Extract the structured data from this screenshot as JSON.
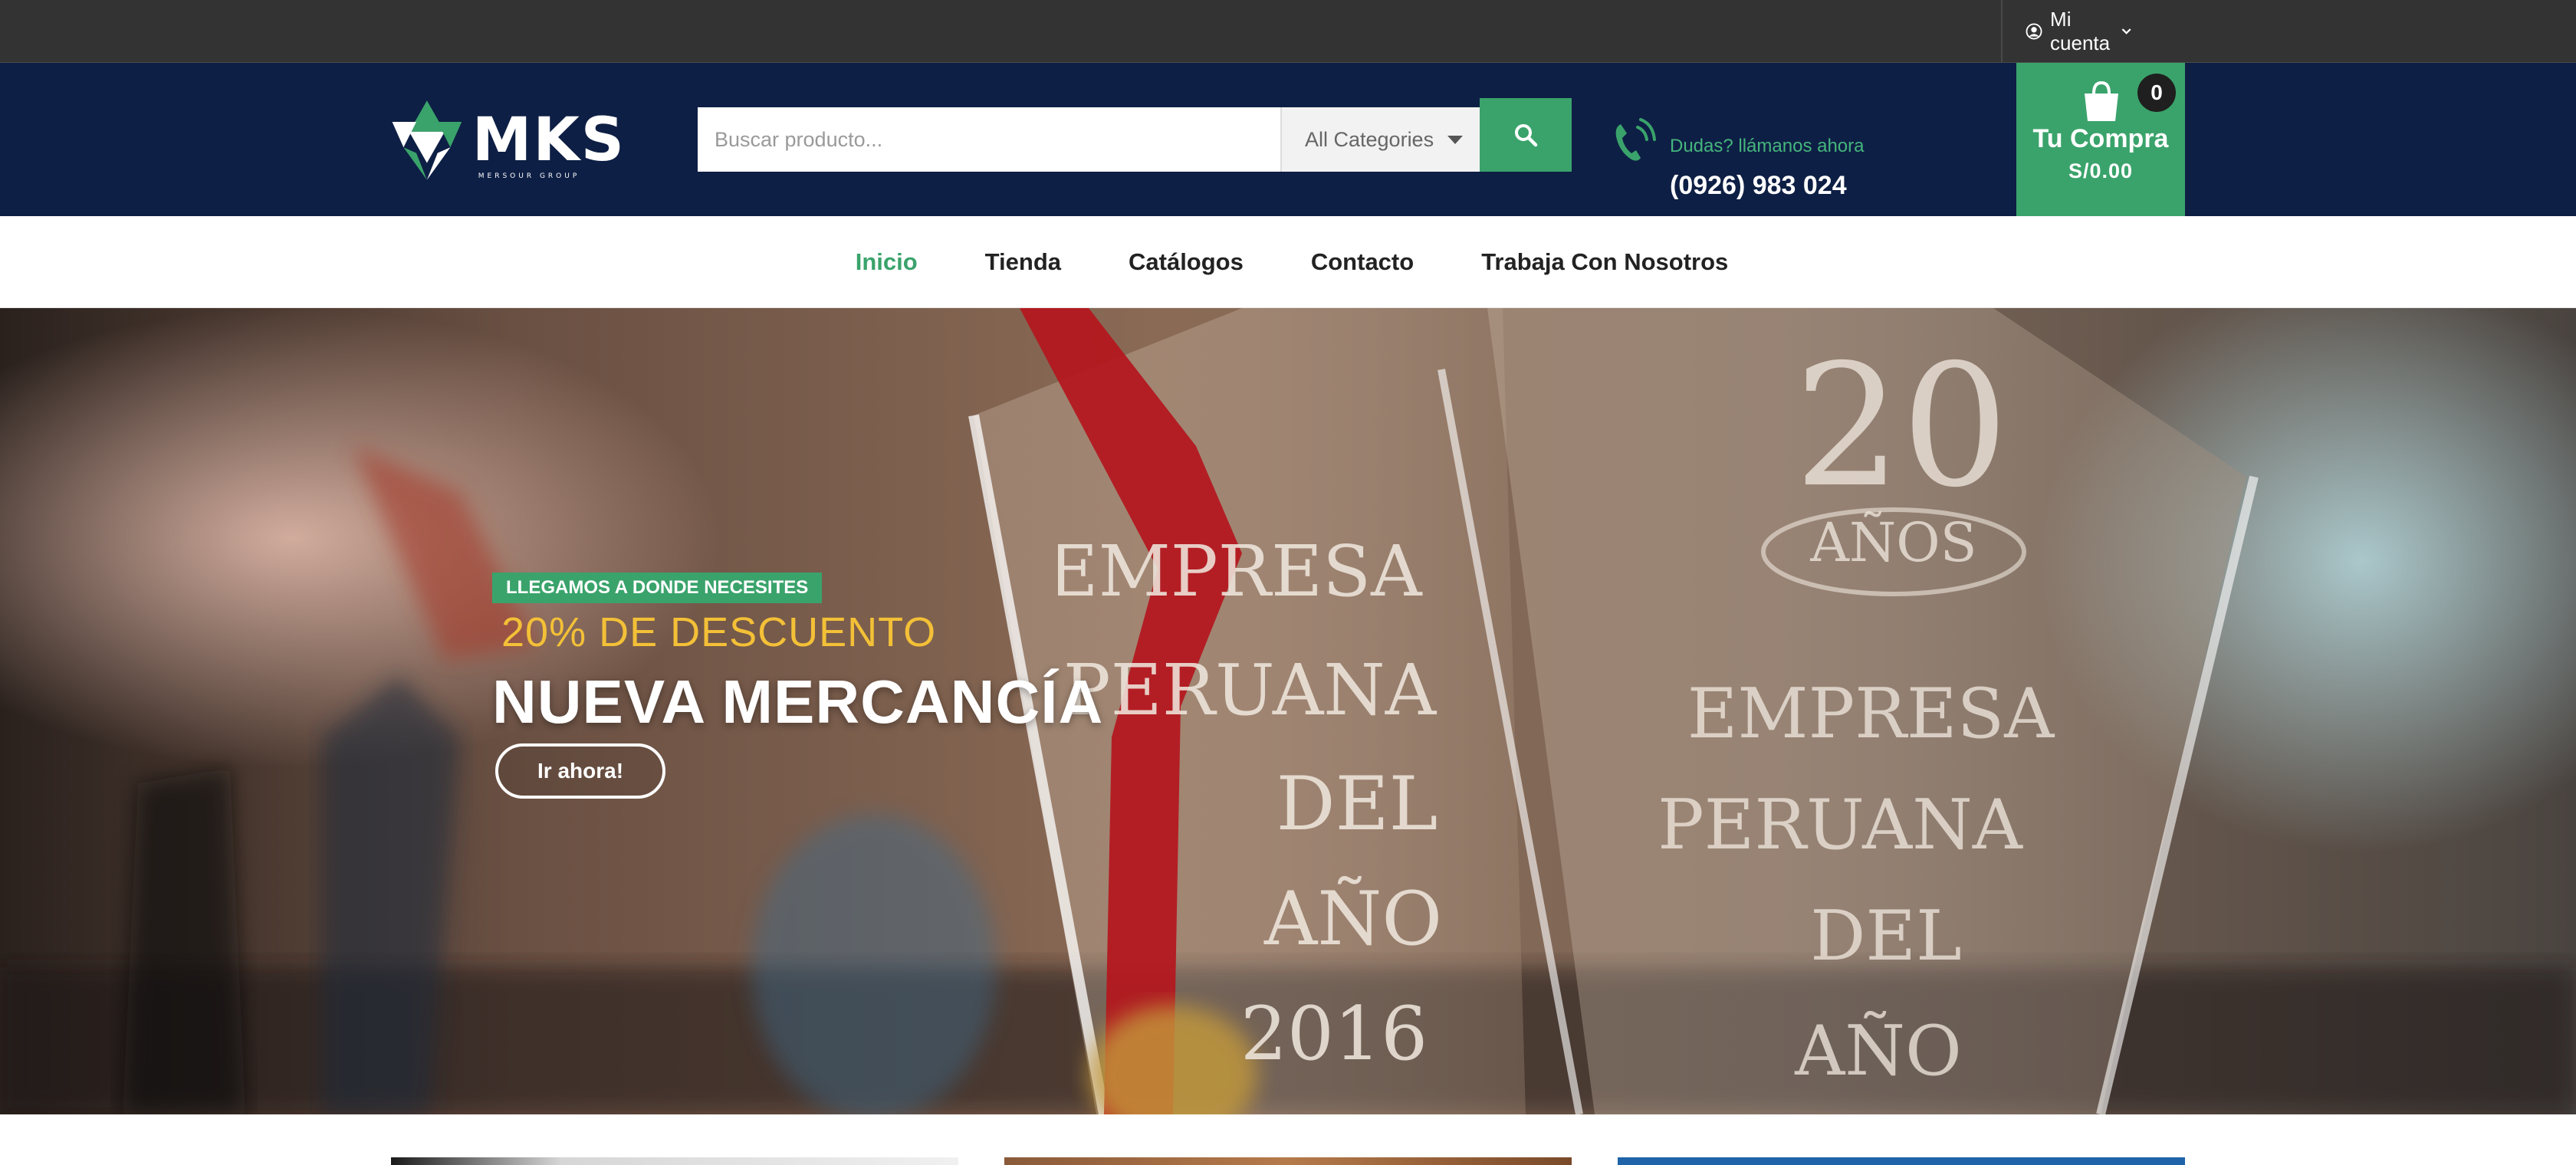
{
  "topbar": {
    "account_label": "Mi cuenta"
  },
  "header": {
    "logo_text": "MKS",
    "logo_tagline": "MERSOUR GROUP",
    "search_placeholder": "Buscar producto...",
    "category_select": "All Categories",
    "call_prompt": "Dudas? llámanos ahora",
    "phone": "(0926) 983 024",
    "cart": {
      "count": "0",
      "label": "Tu Compra",
      "amount": "S/0.00"
    }
  },
  "nav": {
    "items": [
      {
        "label": "Inicio",
        "active": true
      },
      {
        "label": "Tienda",
        "active": false
      },
      {
        "label": "Catálogos",
        "active": false
      },
      {
        "label": "Contacto",
        "active": false
      },
      {
        "label": "Trabaja Con Nosotros",
        "active": false
      }
    ]
  },
  "hero": {
    "kicker": "LLEGAMOS A DONDE NECESITES",
    "discount": "20% DE DESCUENTO",
    "headline": "NUEVA MERCANCÍA",
    "cta": "Ir ahora!",
    "trophy_text_1": [
      "EMPRESA",
      "PERUANA",
      "DEL",
      "AÑO",
      "2016"
    ],
    "trophy_text_2": [
      "20",
      "AÑOS",
      "EMPRESA",
      "PERUANA",
      "DEL",
      "AÑO"
    ]
  },
  "colors": {
    "topbar": "#333333",
    "header": "#0e1f45",
    "accent_green": "#3aa36b",
    "discount_yellow": "#f3c037"
  }
}
